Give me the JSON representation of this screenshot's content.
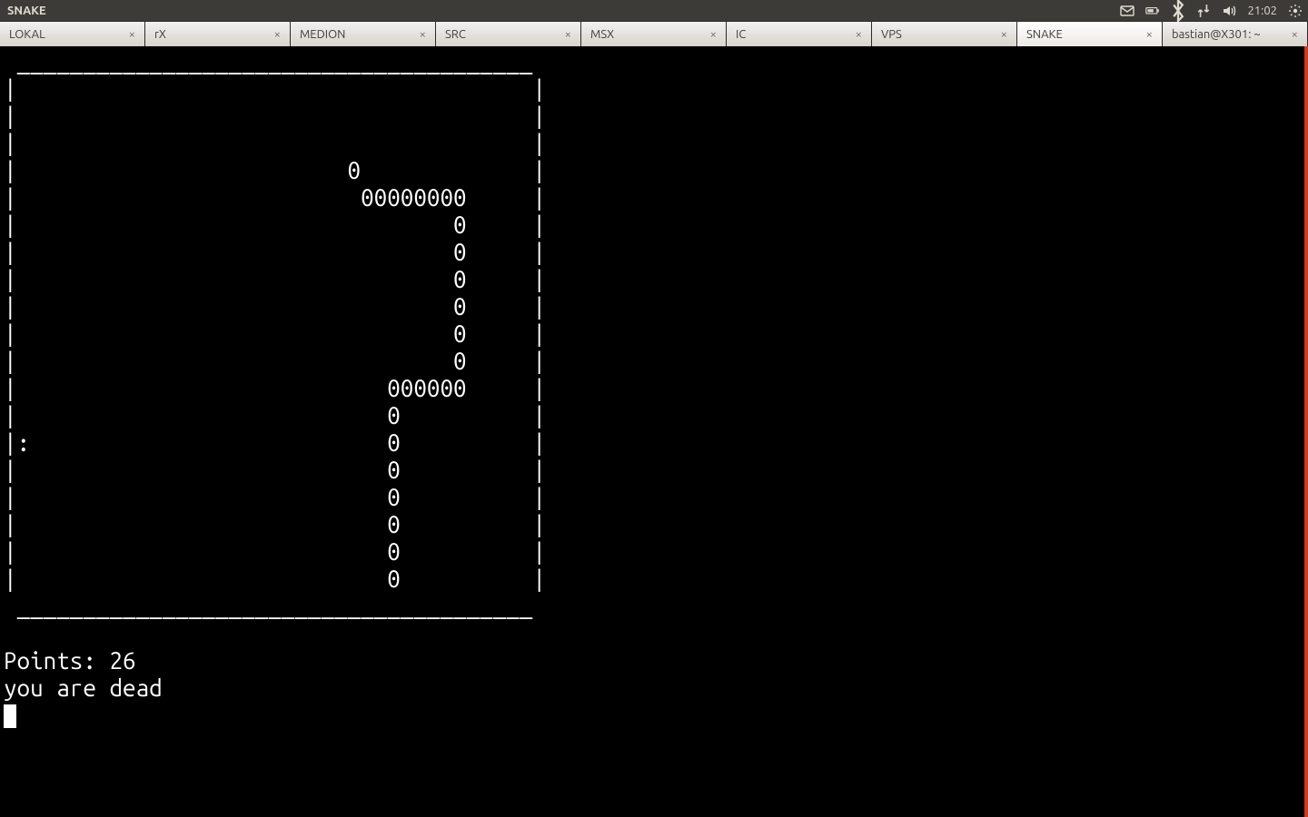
{
  "menubar": {
    "title": "SNAKE",
    "clock": "21:02"
  },
  "tabs": [
    {
      "label": "LOKAL",
      "active": false
    },
    {
      "label": "rX",
      "active": false
    },
    {
      "label": "MEDION",
      "active": false
    },
    {
      "label": "SRC",
      "active": false
    },
    {
      "label": "MSX",
      "active": false
    },
    {
      "label": "IC",
      "active": false
    },
    {
      "label": "VPS",
      "active": false
    },
    {
      "label": "SNAKE",
      "active": true
    },
    {
      "label": "bastian@X301: ~",
      "active": false
    }
  ],
  "game": {
    "board_width_cols": 41,
    "board_rows": [
      "|                                       |",
      "|                                       |",
      "|                                       |",
      "|                         0             |",
      "|                          00000000     |",
      "|                                 0     |",
      "|                                 0     |",
      "|                                 0     |",
      "|                                 0     |",
      "|                                 0     |",
      "|                                 0     |",
      "|                            000000     |",
      "|                            0          |",
      "|:                           0          |",
      "|                            0          |",
      "|                            0          |",
      "|                            0          |",
      "|                            0          |",
      "|                            0          |"
    ],
    "points_label": "Points: ",
    "points_value": "26",
    "status": "you are dead"
  }
}
